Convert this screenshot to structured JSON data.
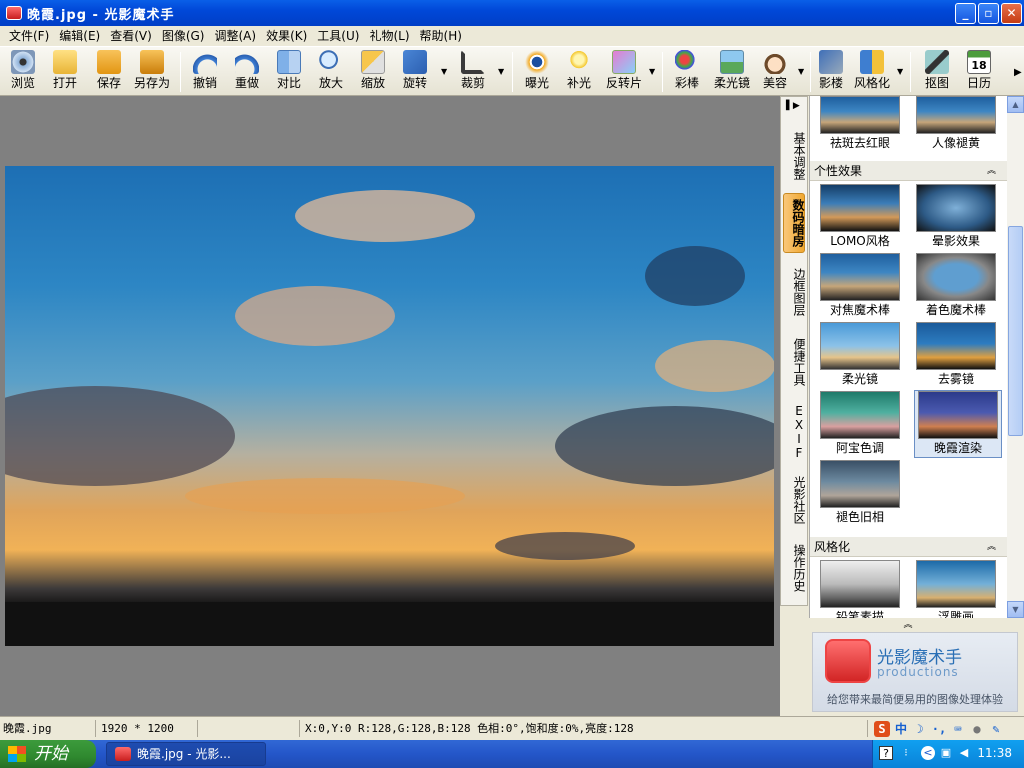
{
  "window": {
    "title": "晚霞.jpg - 光影魔术手",
    "buttons": {
      "min": "_",
      "max": "▫",
      "close": "✕"
    }
  },
  "menu": [
    "文件(F)",
    "编辑(E)",
    "查看(V)",
    "图像(G)",
    "调整(A)",
    "效果(K)",
    "工具(U)",
    "礼物(L)",
    "帮助(H)"
  ],
  "toolbar": {
    "browse": "浏览",
    "open": "打开",
    "save": "保存",
    "save_as": "另存为",
    "undo": "撤销",
    "redo": "重做",
    "compare": "对比",
    "zoom_in": "放大",
    "resize": "缩放",
    "rotate": "旋转",
    "crop": "裁剪",
    "exposure": "曝光",
    "fill_light": "补光",
    "reversal": "反转片",
    "color_pen": "彩棒",
    "soft_lens": "柔光镜",
    "beauty": "美容",
    "shadow": "影楼",
    "stylize": "风格化",
    "cutout": "抠图",
    "calendar": "日历",
    "calendar_num": "18"
  },
  "side_tabs": [
    "基本调整",
    "数码暗房",
    "边框图层",
    "便捷工具",
    "EXIF",
    "光影社区",
    "操作历史"
  ],
  "panel": {
    "top_items": [
      "祛斑去红眼",
      "人像褪黄"
    ],
    "section1": "个性效果",
    "effects": [
      "LOMO风格",
      "晕影效果",
      "对焦魔术棒",
      "着色魔术棒",
      "柔光镜",
      "去雾镜",
      "阿宝色调",
      "晚霞渲染",
      "褪色旧相"
    ],
    "section2": "风格化",
    "style_items": [
      "铅笔素描",
      "浮雕画"
    ]
  },
  "ad": {
    "title": "光影魔术手",
    "subtitle": "productions",
    "slogan": "给您带来最简便易用的图像处理体验"
  },
  "status": {
    "filename": "晚霞.jpg",
    "dimensions": "1920 * 1200",
    "info": "X:0,Y:0 R:128,G:128,B:128 色相:0°,饱和度:0%,亮度:128"
  },
  "taskbar": {
    "start": "开始",
    "task": "晚霞.jpg - 光影...",
    "clock": "11:38"
  },
  "colors": {
    "title_blue": "#0048d8",
    "active_tab": "#f0a830",
    "tray": "#0a82d8"
  }
}
